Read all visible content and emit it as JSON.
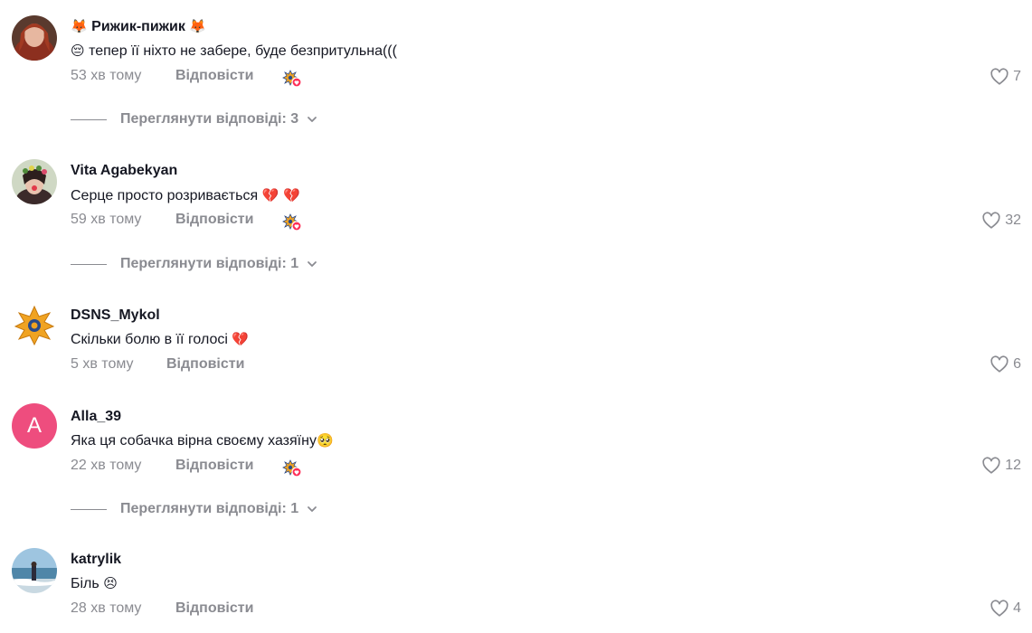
{
  "comments": [
    {
      "username": "Рижик-пижик",
      "username_prefix_emoji": "🦊",
      "username_suffix_emoji": "🦊",
      "text_emoji": "😔",
      "text": "тепер її ніхто не забере, буде безпритульна(((",
      "time": "53 хв тому",
      "reply_label": "Відповісти",
      "likes": "7",
      "creator_liked": true,
      "view_replies": "Переглянути відповіді: 3"
    },
    {
      "username": "Vita Agabekyan",
      "text": "Серце просто розривається",
      "text_emoji": "💔 💔",
      "time": "59 хв тому",
      "reply_label": "Відповісти",
      "likes": "32",
      "creator_liked": true,
      "view_replies": "Переглянути відповіді: 1"
    },
    {
      "username": "DSNS_Mykol",
      "text": "Скільки болю в її голосі",
      "text_emoji": "💔",
      "time": "5 хв тому",
      "reply_label": "Відповісти",
      "likes": "6",
      "creator_liked": false
    },
    {
      "username": "Alla_39",
      "avatar_letter": "A",
      "text": "Яка ця собачка вірна своєму хазяїну",
      "text_emoji": "🥺",
      "time": "22 хв тому",
      "reply_label": "Відповісти",
      "likes": "12",
      "creator_liked": true,
      "view_replies": "Переглянути відповіді: 1"
    },
    {
      "username": "katrylik",
      "text": "Біль",
      "text_emoji": "😣",
      "time": "28 хв тому",
      "reply_label": "Відповісти",
      "likes": "4",
      "creator_liked": false
    }
  ],
  "colors": {
    "muted_text": "#8a8b91",
    "primary_text": "#161823",
    "letter_avatar_bg": "#ee4d7e",
    "heart_badge": "#fe2c55",
    "dsns_orange": "#f0a322",
    "dsns_blue": "#2a4a8a"
  },
  "icons": {
    "like": "heart-outline-icon",
    "expand": "chevron-down-icon",
    "creator_liked": "creator-liked-badge-icon"
  }
}
